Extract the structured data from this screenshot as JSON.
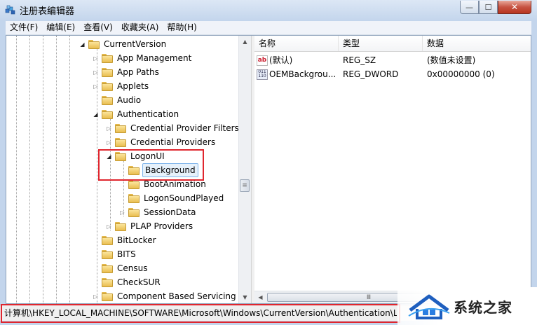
{
  "window": {
    "title": "注册表编辑器",
    "controls": {
      "minimize": "—",
      "maximize": "☐",
      "close": "✕"
    }
  },
  "menu": [
    "文件(F)",
    "编辑(E)",
    "查看(V)",
    "收藏夹(A)",
    "帮助(H)"
  ],
  "tree": {
    "nodes": [
      {
        "label": "CurrentVersion",
        "expander": "open"
      },
      {
        "label": "App Management",
        "expander": "closed"
      },
      {
        "label": "App Paths",
        "expander": "closed"
      },
      {
        "label": "Applets",
        "expander": "closed"
      },
      {
        "label": "Audio",
        "expander": "none"
      },
      {
        "label": "Authentication",
        "expander": "open"
      },
      {
        "label": "Credential Provider Filters",
        "expander": "closed"
      },
      {
        "label": "Credential Providers",
        "expander": "closed"
      },
      {
        "label": "LogonUI",
        "expander": "open"
      },
      {
        "label": "Background",
        "expander": "none",
        "selected": true
      },
      {
        "label": "BootAnimation",
        "expander": "none"
      },
      {
        "label": "LogonSoundPlayed",
        "expander": "none"
      },
      {
        "label": "SessionData",
        "expander": "closed"
      },
      {
        "label": "PLAP Providers",
        "expander": "closed"
      },
      {
        "label": "BitLocker",
        "expander": "none"
      },
      {
        "label": "BITS",
        "expander": "none"
      },
      {
        "label": "Census",
        "expander": "none"
      },
      {
        "label": "CheckSUR",
        "expander": "none"
      },
      {
        "label": "Component Based Servicing",
        "expander": "closed"
      }
    ]
  },
  "list": {
    "columns": [
      "名称",
      "类型",
      "数据"
    ],
    "rows": [
      {
        "icon": "string-value-icon",
        "name": "(默认)",
        "type": "REG_SZ",
        "data": "(数值未设置)"
      },
      {
        "icon": "dword-value-icon",
        "name": "OEMBackgrou...",
        "type": "REG_DWORD",
        "data": "0x00000000 (0)"
      }
    ]
  },
  "statusbar": {
    "path": "计算机\\HKEY_LOCAL_MACHINE\\SOFTWARE\\Microsoft\\Windows\\CurrentVersion\\Authentication\\L"
  },
  "scroll_glyphs": {
    "up": "▲",
    "down": "▼",
    "left": "◀",
    "grip_v": "≡",
    "grip_h": "Ⅲ"
  },
  "watermark": {
    "text": "系统之家"
  },
  "highlight_color": "#e0262e"
}
